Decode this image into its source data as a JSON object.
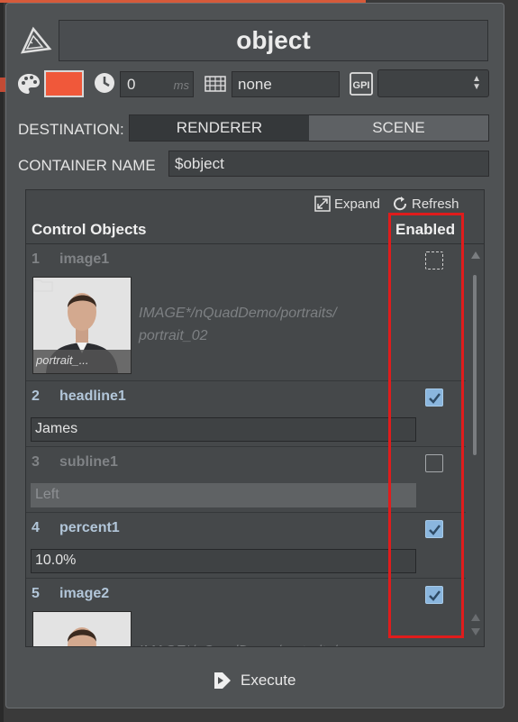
{
  "header": {
    "title": "object"
  },
  "properties": {
    "color": "#f0583a",
    "time_value": "0",
    "time_unit": "ms",
    "grid_value": "none",
    "gpi_label": "GPI",
    "gpi_value": ""
  },
  "destination": {
    "label": "DESTINATION:",
    "options": [
      "RENDERER",
      "SCENE"
    ],
    "selected": "RENDERER"
  },
  "container": {
    "label": "CONTAINER NAME",
    "value": "$object"
  },
  "control_objects": {
    "toolbar": {
      "expand": "Expand",
      "refresh": "Refresh"
    },
    "header": {
      "name": "Control Objects",
      "enabled": "Enabled"
    },
    "rows": [
      {
        "num": "1",
        "name": "image1",
        "enabled": false,
        "thumb_label": "portrait_...",
        "path": "IMAGE*/nQuadDemo/portraits/ portrait_02"
      },
      {
        "num": "2",
        "name": "headline1",
        "enabled": true,
        "value": "James"
      },
      {
        "num": "3",
        "name": "subline1",
        "enabled": false,
        "value": "Left"
      },
      {
        "num": "4",
        "name": "percent1",
        "enabled": true,
        "value": "10.0%"
      },
      {
        "num": "5",
        "name": "image2",
        "enabled": true,
        "path": "IMAGE*/nQuadDemo/portraits/"
      }
    ]
  },
  "footer": {
    "execute": "Execute"
  }
}
